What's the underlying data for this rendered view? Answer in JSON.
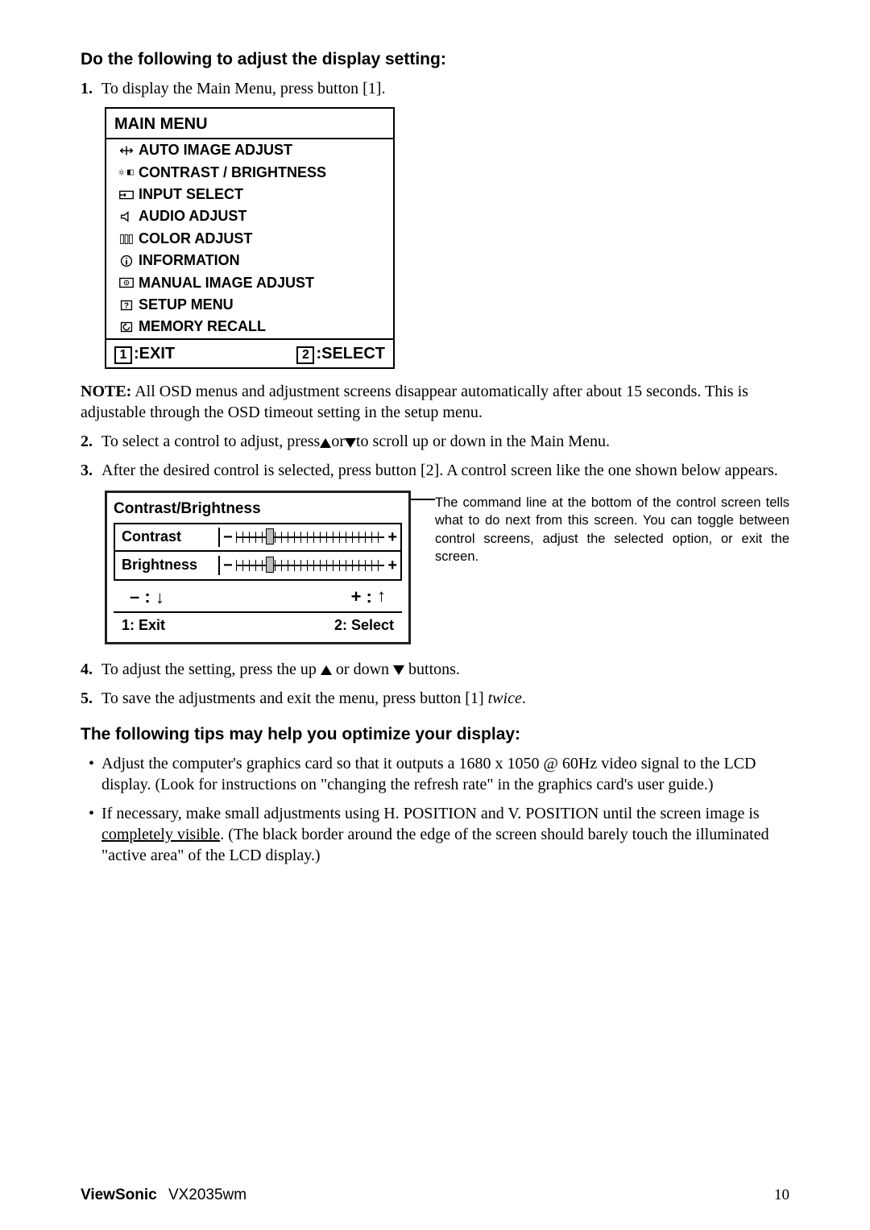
{
  "h1": "Do the following to adjust the display setting:",
  "step1_n": "1.",
  "step1_t": "To display the Main Menu, press button [1].",
  "osd": {
    "title": "MAIN MENU",
    "items": [
      "AUTO IMAGE ADJUST",
      "CONTRAST / BRIGHTNESS",
      "INPUT SELECT",
      "AUDIO ADJUST",
      "COLOR ADJUST",
      "INFORMATION",
      "MANUAL IMAGE ADJUST",
      "SETUP MENU",
      "MEMORY RECALL"
    ],
    "foot1_key": "1",
    "foot1_lbl": ":EXIT",
    "foot2_key": "2",
    "foot2_lbl": ":SELECT"
  },
  "note_lead": "NOTE:",
  "note_body": " All OSD menus and adjustment screens disappear automatically after about 15 seconds. This is adjustable through the OSD timeout setting in the setup menu.",
  "step2_n": "2.",
  "step2_pre": "To select a control to adjust, press",
  "step2_mid": "or",
  "step2_post": "to scroll up or down in the Main Menu.",
  "step3_n": "3.",
  "step3_t": "After the desired control is selected, press button [2]. A control screen like the one shown below appears.",
  "cb": {
    "head": "Contrast/Brightness",
    "r1": "Contrast",
    "r2": "Brightness",
    "minus": "– :",
    "plus": "+ :",
    "exit": "1: Exit",
    "select": "2: Select"
  },
  "callout": "The command line at the bottom of the control screen tells what to do next from this screen. You can toggle between control screens, adjust the selected option, or exit the screen.",
  "step4_n": "4.",
  "step4_pre": "To adjust the setting, press the up ",
  "step4_mid": " or down ",
  "step4_post": " buttons.",
  "step5_n": "5.",
  "step5_pre": "To save the adjustments and exit the menu, press button [1] ",
  "step5_ital": "twice",
  "step5_post": ".",
  "h2": "The following tips may help you optimize your display:",
  "tip1": "Adjust the computer's graphics card so that it outputs a 1680 x 1050 @ 60Hz video signal to the LCD display. (Look for instructions on \"changing the refresh rate\" in the graphics card's user guide.)",
  "tip2_pre": "If necessary, make small adjustments using H. POSITION and V. POSITION until the screen image is ",
  "tip2_ul": "completely visible",
  "tip2_post": ". (The black border around the edge of the screen should barely touch the illuminated \"active area\" of the LCD display.)",
  "footer_brand": "ViewSonic",
  "footer_model": "VX2035wm",
  "footer_page": "10"
}
